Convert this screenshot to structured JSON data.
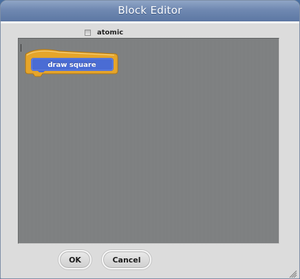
{
  "dialog": {
    "title": "Block Editor",
    "atomic": {
      "label": "atomic",
      "checked": false
    },
    "prototype_block": {
      "label": "draw square",
      "hat_color": "#e6a52a",
      "block_color": "#4a6cd4"
    },
    "buttons": {
      "ok": "OK",
      "cancel": "Cancel"
    },
    "resize_icon": "resize-grip-icon"
  }
}
